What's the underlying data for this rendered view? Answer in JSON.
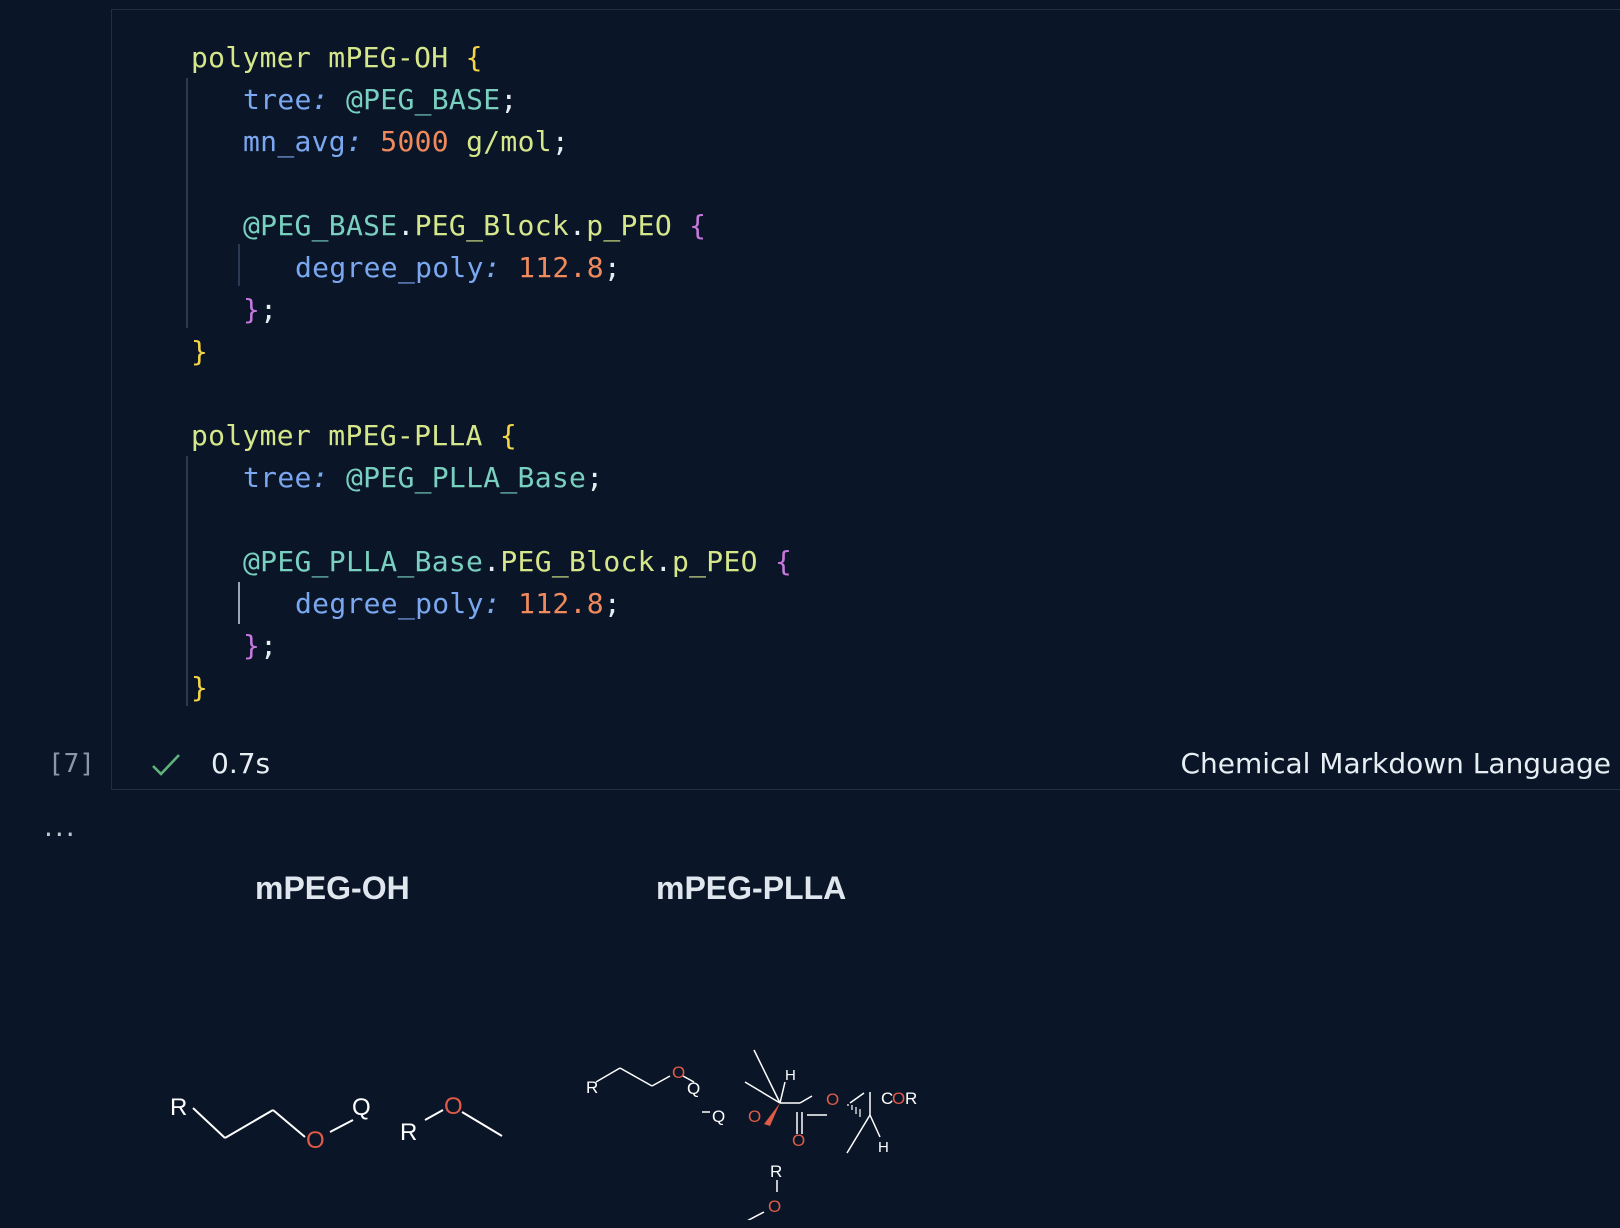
{
  "cell": {
    "execution_count": "[7]",
    "duration": "0.7s",
    "language": "Chemical Markdown Language",
    "output_prompt": "..."
  },
  "code": {
    "l1_kw": "polymer",
    "l1_name": "mPEG-OH",
    "l1_brace": "{",
    "l2_prop": "tree",
    "l2_colon": ":",
    "l2_val": "@PEG_BASE",
    "l2_semi": ";",
    "l3_prop": "mn_avg",
    "l3_colon": ":",
    "l3_num": "5000",
    "l3_unit": "g/mol",
    "l3_semi": ";",
    "l5_ref": "@PEG_BASE",
    "l5_d1": ".",
    "l5_p1": "PEG_Block",
    "l5_d2": ".",
    "l5_p2": "p_PEO",
    "l5_brace": "{",
    "l6_prop": "degree_poly",
    "l6_colon": ":",
    "l6_num": "112.8",
    "l6_semi": ";",
    "l7_brace": "}",
    "l7_semi": ";",
    "l8_brace": "}",
    "l10_kw": "polymer",
    "l10_name": "mPEG-PLLA",
    "l10_brace": "{",
    "l11_prop": "tree",
    "l11_colon": ":",
    "l11_val": "@PEG_PLLA_Base",
    "l11_semi": ";",
    "l13_ref": "@PEG_PLLA_Base",
    "l13_d1": ".",
    "l13_p1": "PEG_Block",
    "l13_d2": ".",
    "l13_p2": "p_PEO",
    "l13_brace": "{",
    "l14_prop": "degree_poly",
    "l14_colon": ":",
    "l14_num": "112.8",
    "l14_semi": ";",
    "l15_brace": "}",
    "l15_semi": ";",
    "l16_brace": "}"
  },
  "output": {
    "mol1": {
      "title": "mPEG-OH",
      "atoms": {
        "r1": "R",
        "o1": "O",
        "q1": "Q",
        "r2": "R",
        "o2": "O"
      }
    },
    "mol2": {
      "title": "mPEG-PLLA",
      "atoms": {
        "r1": "R",
        "o1": "O",
        "q1": "Q",
        "h1": "H",
        "q2": "Q",
        "o2": "O",
        "o3": "O",
        "o4": "O",
        "c1": "C",
        "o5": "O",
        "r2": "R",
        "h2": "H",
        "r3": "R",
        "o6": "O"
      }
    }
  },
  "colors": {
    "background": "#0a1627",
    "keyword": "#d6e68a",
    "brace_outer": "#f5d547",
    "brace_inner": "#c678dd",
    "property": "#7aa7ef",
    "reference": "#79d0c0",
    "number": "#f08a5d",
    "oxygen": "#e05a48",
    "success": "#5fb27a"
  }
}
